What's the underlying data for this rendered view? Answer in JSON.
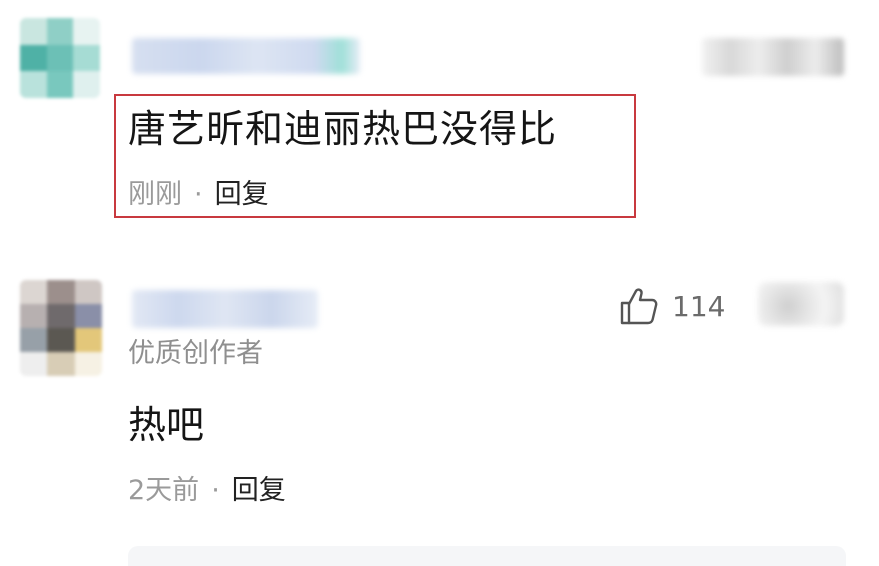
{
  "comments": [
    {
      "text": "唐艺昕和迪丽热巴没得比",
      "time": "刚刚",
      "separator": "·",
      "reply_label": "回复",
      "highlighted": true,
      "highlight_color": "#c8393f"
    },
    {
      "badge": "优质创作者",
      "like_icon": "thumbs-up-icon",
      "like_count": "114",
      "text": "热吧",
      "time": "2天前",
      "separator": "·",
      "reply_label": "回复"
    }
  ],
  "colors": {
    "body_text": "#151515",
    "secondary_text": "#9a9a9a",
    "reply_text": "#222222",
    "highlight_border": "#c8393f"
  }
}
